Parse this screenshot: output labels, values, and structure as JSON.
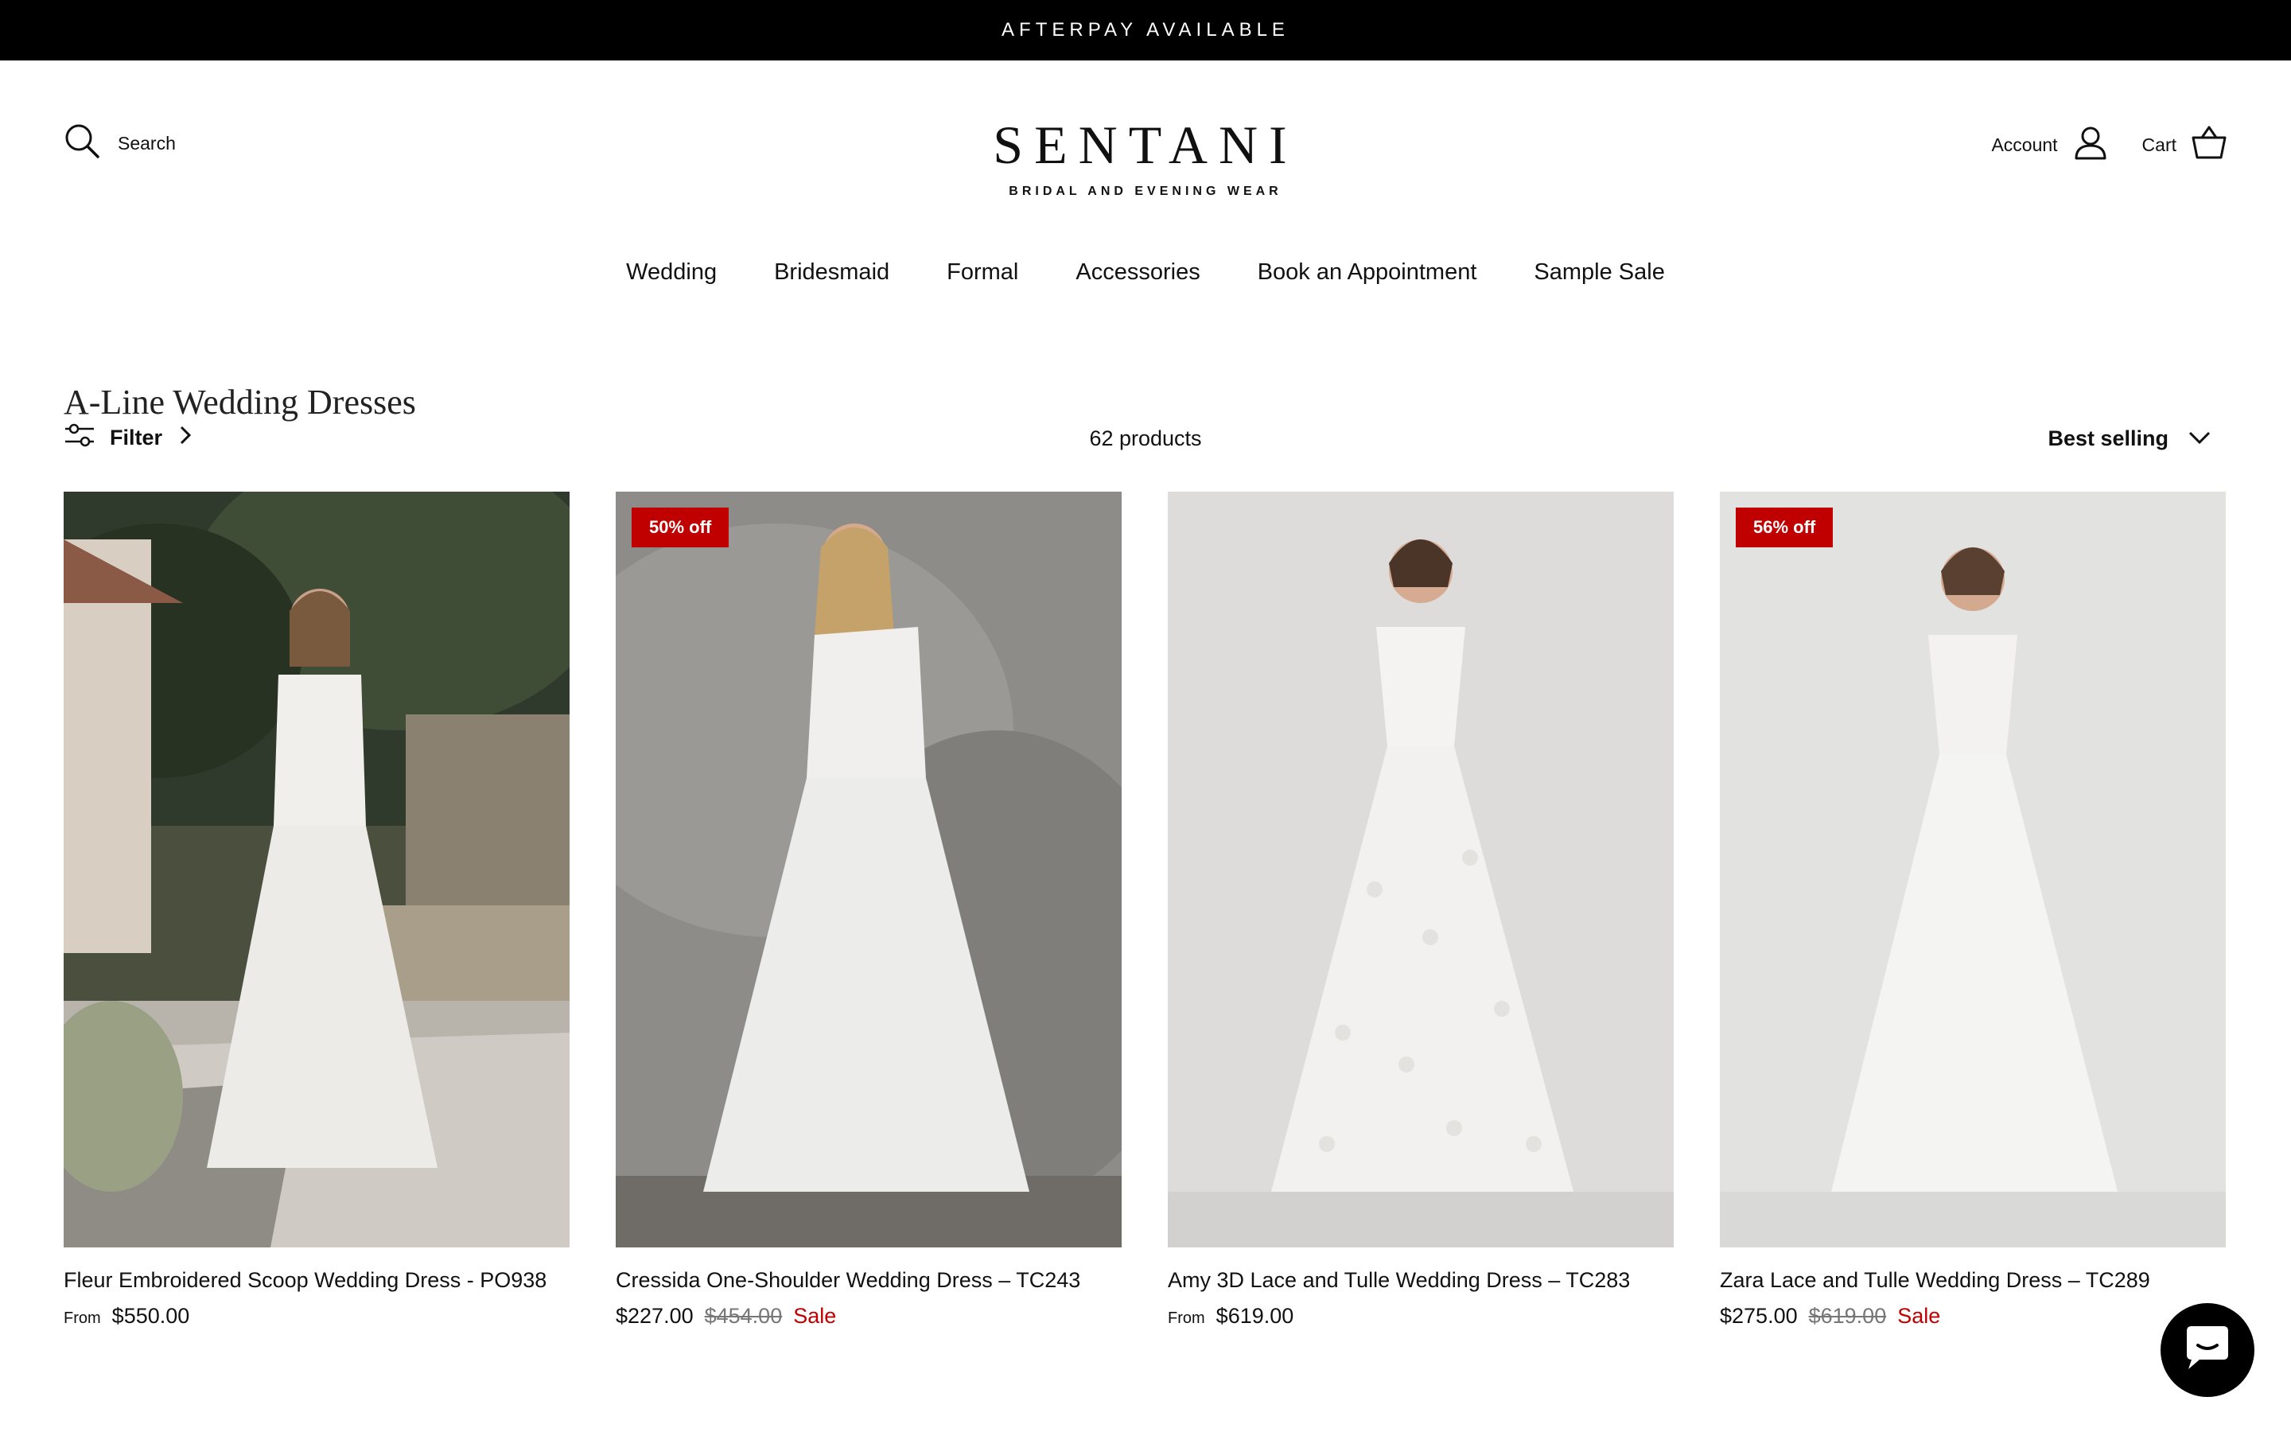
{
  "announcement": "AFTERPAY AVAILABLE",
  "header": {
    "search_label": "Search",
    "logo_main": "SENTANI",
    "logo_sub": "BRIDAL AND EVENING WEAR",
    "account_label": "Account",
    "cart_label": "Cart"
  },
  "nav": {
    "items": [
      "Wedding",
      "Bridesmaid",
      "Formal",
      "Accessories",
      "Book an Appointment",
      "Sample Sale"
    ]
  },
  "collection": {
    "title": "A-Line Wedding Dresses",
    "filter_label": "Filter",
    "count": "62 products",
    "sort_label": "Best selling"
  },
  "products": [
    {
      "name": "Fleur Embroidered Scoop Wedding Dress - PO938",
      "from": "From",
      "price": "$550.00",
      "compare": "",
      "sale": "",
      "badge": ""
    },
    {
      "name": "Cressida One-Shoulder Wedding Dress – TC243",
      "from": "",
      "price": "$227.00",
      "compare": "$454.00",
      "sale": "Sale",
      "badge": "50% off"
    },
    {
      "name": "Amy 3D Lace and Tulle Wedding Dress – TC283",
      "from": "From",
      "price": "$619.00",
      "compare": "",
      "sale": "",
      "badge": ""
    },
    {
      "name": "Zara Lace and Tulle Wedding Dress – TC289",
      "from": "",
      "price": "$275.00",
      "compare": "$619.00",
      "sale": "Sale",
      "badge": "56% off"
    }
  ],
  "colors": {
    "accent_sale": "#c00000",
    "announcement_bg": "#000000"
  },
  "icons": {
    "search": "search-icon",
    "account": "user-icon",
    "cart": "basket-icon",
    "filter": "sliders-icon",
    "chat": "chat-icon"
  }
}
